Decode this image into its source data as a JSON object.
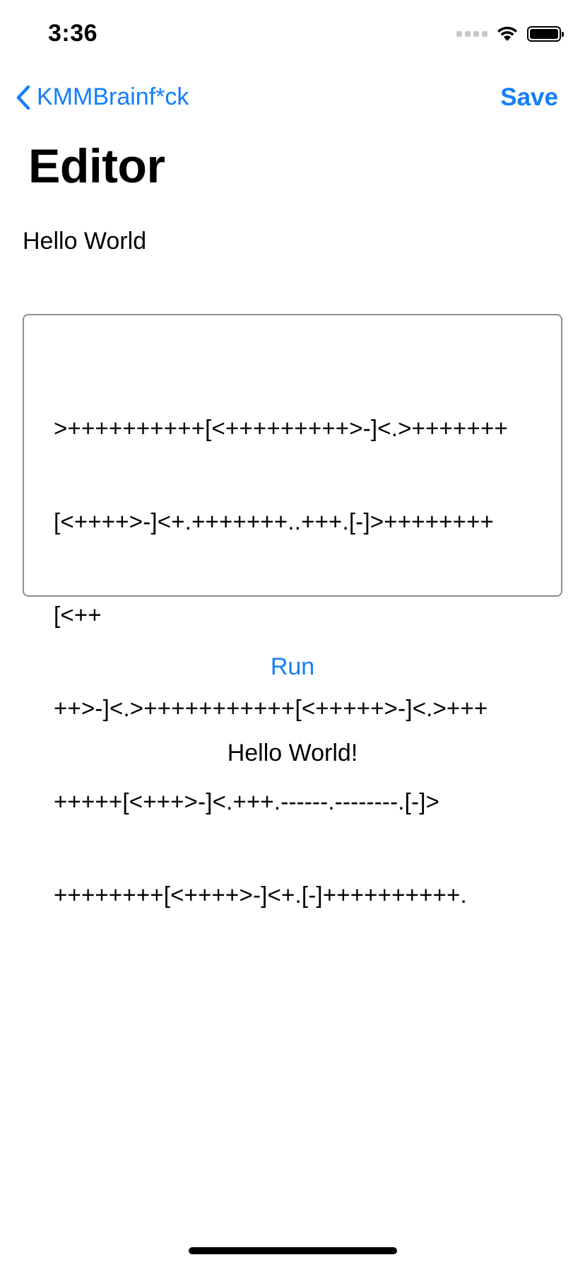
{
  "status_bar": {
    "time": "3:36",
    "icons": [
      "signal-icon",
      "wifi-icon",
      "battery-icon"
    ]
  },
  "nav": {
    "back_label": "KMMBrainf*ck",
    "save_label": "Save"
  },
  "page": {
    "title": "Editor",
    "program_name": "Hello World"
  },
  "editor": {
    "code_lines": [
      ">++++++++++[<+++++++++>-]<.>+++++++",
      "[<++++>-]<+.+++++++..+++.[-]>++++++++",
      "[<++",
      "++>-]<.>+++++++++++[<+++++>-]<.>+++",
      "+++++[<+++>-]<.+++.------.--------.[-]>",
      "++++++++[<++++>-]<+.[-]++++++++++."
    ]
  },
  "run_label": "Run",
  "output_text": "Hello World!",
  "colors": {
    "accent": "#147EFB",
    "border": "#8e8e93",
    "text": "#000000",
    "background": "#ffffff"
  }
}
